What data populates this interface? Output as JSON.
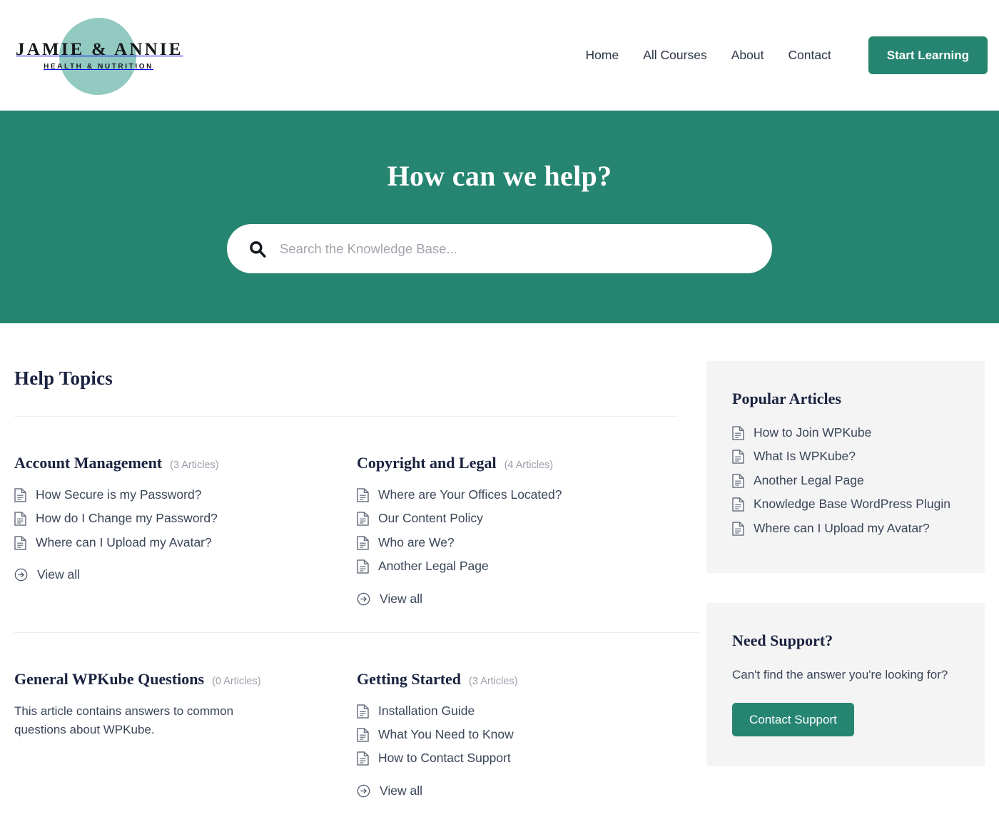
{
  "header": {
    "logo": {
      "main_text": "JAMIE & ANNIE",
      "sub_text": "HEALTH & NUTRITION",
      "blob_color": "#92cac1"
    },
    "nav": [
      {
        "label": "Home"
      },
      {
        "label": "All Courses"
      },
      {
        "label": "About"
      },
      {
        "label": "Contact"
      }
    ],
    "cta_label": "Start Learning"
  },
  "hero": {
    "title": "How can we help?",
    "search_placeholder": "Search the Knowledge Base...",
    "search_value": "",
    "background_color": "#268571"
  },
  "main": {
    "section_title": "Help Topics",
    "topics": [
      {
        "name": "Account Management",
        "count": "(3 Articles)",
        "articles": [
          "How Secure is my Password?",
          "How do I Change my Password?",
          "Where can I Upload my Avatar?"
        ],
        "view_all": "View all"
      },
      {
        "name": "Copyright and Legal",
        "count": "(4 Articles)",
        "articles": [
          "Where are Your Offices Located?",
          "Our Content Policy",
          "Who are We?",
          "Another Legal Page"
        ],
        "view_all": "View all"
      },
      {
        "name": "General WPKube Questions",
        "count": "(0 Articles)",
        "description": "This article contains answers to common questions about WPKube.",
        "articles": []
      },
      {
        "name": "Getting Started",
        "count": "(3 Articles)",
        "articles": [
          "Installation Guide",
          "What You Need to Know",
          "How to Contact Support"
        ],
        "view_all": "View all"
      }
    ]
  },
  "sidebar": {
    "popular": {
      "title": "Popular Articles",
      "articles": [
        "How to Join WPKube",
        "What Is WPKube?",
        "Another Legal Page",
        "Knowledge Base WordPress Plugin",
        "Where can I Upload my Avatar?"
      ]
    },
    "support": {
      "title": "Need Support?",
      "text": "Can't find the answer you're looking for?",
      "button_label": "Contact Support",
      "button_color": "#268571"
    }
  }
}
